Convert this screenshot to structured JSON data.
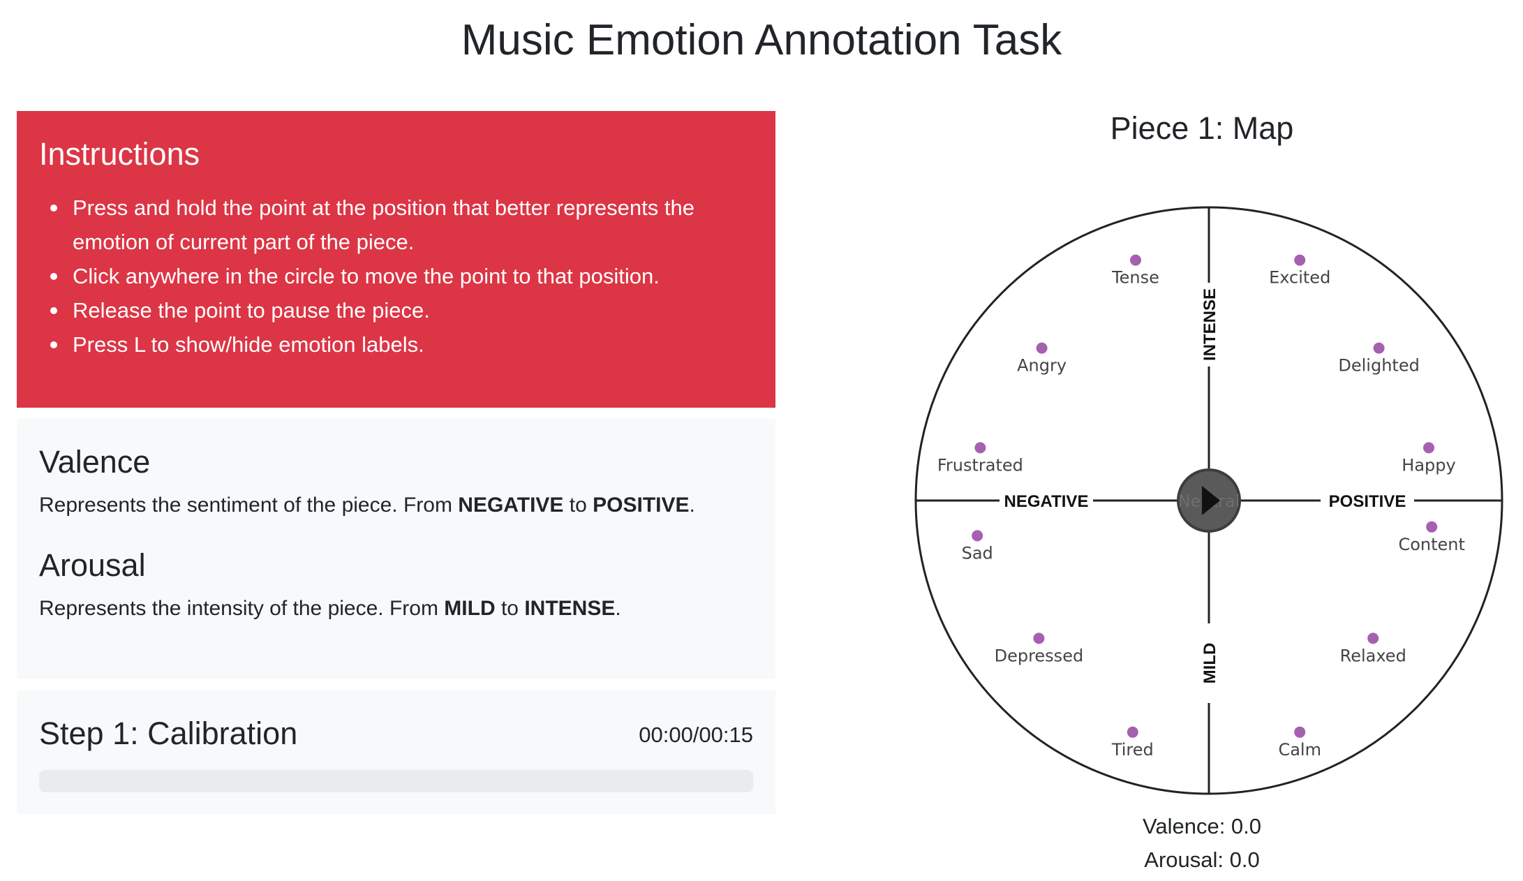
{
  "page": {
    "title": "Music Emotion Annotation Task"
  },
  "instructions": {
    "title": "Instructions",
    "items": [
      "Press and hold the point at the position that better represents the emotion of current part of the piece.",
      "Click anywhere in the circle to move the point to that position.",
      "Release the point to pause the piece.",
      "Press L to show/hide emotion labels."
    ]
  },
  "info": {
    "valence": {
      "title": "Valence",
      "text_pre": "Represents the sentiment of the piece. From ",
      "low": "NEGATIVE",
      "mid": " to ",
      "high": "POSITIVE",
      "end": "."
    },
    "arousal": {
      "title": "Arousal",
      "text_pre": "Represents the intensity of the piece. From ",
      "low": "MILD",
      "mid": " to ",
      "high": "INTENSE",
      "end": "."
    }
  },
  "step": {
    "title": "Step 1: Calibration",
    "timer": "00:00/00:15",
    "progress": 0
  },
  "map": {
    "title": "Piece 1: Map",
    "axes": {
      "left": "NEGATIVE",
      "right": "POSITIVE",
      "top": "INTENSE",
      "bottom": "MILD"
    },
    "center_label": "Neutral",
    "emotions": [
      {
        "name": "Tense",
        "valence": -0.25,
        "arousal": 0.82
      },
      {
        "name": "Excited",
        "valence": 0.31,
        "arousal": 0.82
      },
      {
        "name": "Angry",
        "valence": -0.57,
        "arousal": 0.52
      },
      {
        "name": "Delighted",
        "valence": 0.58,
        "arousal": 0.52
      },
      {
        "name": "Frustrated",
        "valence": -0.78,
        "arousal": 0.18
      },
      {
        "name": "Happy",
        "valence": 0.75,
        "arousal": 0.18
      },
      {
        "name": "Sad",
        "valence": -0.79,
        "arousal": -0.12
      },
      {
        "name": "Content",
        "valence": 0.76,
        "arousal": -0.09
      },
      {
        "name": "Depressed",
        "valence": -0.58,
        "arousal": -0.47
      },
      {
        "name": "Relaxed",
        "valence": 0.56,
        "arousal": -0.47
      },
      {
        "name": "Tired",
        "valence": -0.26,
        "arousal": -0.79
      },
      {
        "name": "Calm",
        "valence": 0.31,
        "arousal": -0.79
      }
    ],
    "readout": {
      "valence_label": "Valence: ",
      "valence": "0.0",
      "arousal_label": "Arousal: ",
      "arousal": "0.0"
    }
  },
  "colors": {
    "instructions_bg": "#dc3545",
    "card_bg": "#f8f9fa",
    "progress_track": "#e9ecef",
    "emotion_dot": "#a660b0",
    "play_button": "#5a5a5a"
  }
}
